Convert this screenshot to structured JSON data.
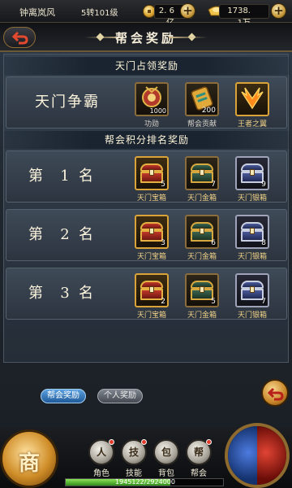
{
  "topbar": {
    "player_name": "钟离岚风",
    "level": "5转101级",
    "copper": "2. 6亿",
    "gold": "1738. 1万"
  },
  "window": {
    "title": "帮会奖励"
  },
  "occupy": {
    "header": "天门占领奖励",
    "row_label": "天门争霸",
    "items": [
      {
        "name": "功勋",
        "count": "1000",
        "icon": "medal-icon"
      },
      {
        "name": "帮会贡献",
        "count": "200",
        "icon": "contribution-scroll-icon"
      },
      {
        "name": "王者之翼",
        "count": "",
        "icon": "king-wings-icon"
      }
    ]
  },
  "ranking": {
    "header": "帮会积分排名奖励",
    "ranks": [
      {
        "prefix": "第",
        "num": "1",
        "suffix": "名",
        "items": [
          {
            "name": "天门宝箱",
            "count": "5"
          },
          {
            "name": "天门金箱",
            "count": "7"
          },
          {
            "name": "天门银箱",
            "count": "9"
          }
        ]
      },
      {
        "prefix": "第",
        "num": "2",
        "suffix": "名",
        "items": [
          {
            "name": "天门宝箱",
            "count": "3"
          },
          {
            "name": "天门金箱",
            "count": "6"
          },
          {
            "name": "天门银箱",
            "count": "8"
          }
        ]
      },
      {
        "prefix": "第",
        "num": "3",
        "suffix": "名",
        "items": [
          {
            "name": "天门宝箱",
            "count": "2"
          },
          {
            "name": "天门金箱",
            "count": "5"
          },
          {
            "name": "天门银箱",
            "count": "7"
          }
        ]
      }
    ]
  },
  "tabs": [
    {
      "label": "帮会奖励",
      "active": true
    },
    {
      "label": "个人奖励",
      "active": false
    }
  ],
  "hud": {
    "shop_label": "商",
    "menu": [
      {
        "label": "角色",
        "icon": "character-icon"
      },
      {
        "label": "技能",
        "icon": "skill-icon"
      },
      {
        "label": "背包",
        "icon": "bag-icon"
      },
      {
        "label": "帮会",
        "icon": "guild-icon"
      }
    ],
    "xp_text": "1945122/2924000",
    "xp_progress": 0.665
  },
  "colors": {
    "accent_gold": "#d9a33a",
    "tab_active": "#2f6fb3",
    "item_name": "#f3d489"
  }
}
